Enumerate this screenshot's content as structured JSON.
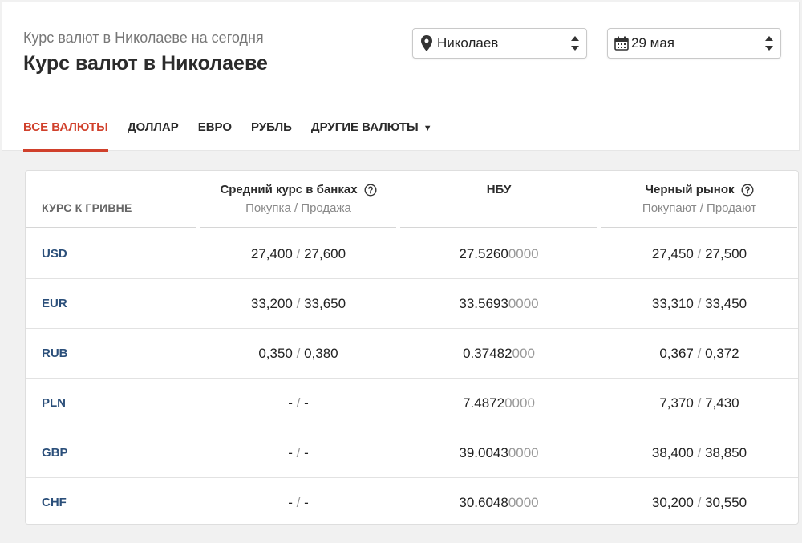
{
  "header": {
    "subtitle": "Курс валют в Николаеве на сегодня",
    "title": "Курс валют в Николаеве",
    "city_select": {
      "value": "Николаев",
      "icon": "map-pin-icon"
    },
    "date_select": {
      "value": "29 мая",
      "icon": "calendar-icon"
    }
  },
  "tabs": [
    {
      "label": "ВСЕ ВАЛЮТЫ",
      "active": true
    },
    {
      "label": "ДОЛЛАР"
    },
    {
      "label": "ЕВРО"
    },
    {
      "label": "РУБЛЬ"
    },
    {
      "label": "ДРУГИЕ ВАЛЮТЫ",
      "caret": "▼"
    }
  ],
  "table": {
    "first_header": "КУРС К ГРИВНЕ",
    "columns": [
      {
        "title": "Средний курс в банках",
        "subtitle": "Покупка / Продажа",
        "help": true
      },
      {
        "title": "НБУ",
        "subtitle": "",
        "help": false
      },
      {
        "title": "Черный рынок",
        "subtitle": "Покупают / Продают",
        "help": true
      }
    ],
    "rows": [
      {
        "code": "USD",
        "bank_buy": "27,400",
        "bank_sell": "27,600",
        "nbu_main": "27.5260",
        "nbu_tail": "0000",
        "black_buy": "27,450",
        "black_sell": "27,500"
      },
      {
        "code": "EUR",
        "bank_buy": "33,200",
        "bank_sell": "33,650",
        "nbu_main": "33.5693",
        "nbu_tail": "0000",
        "black_buy": "33,310",
        "black_sell": "33,450"
      },
      {
        "code": "RUB",
        "bank_buy": "0,350",
        "bank_sell": "0,380",
        "nbu_main": "0.37482",
        "nbu_tail": "000",
        "black_buy": "0,367",
        "black_sell": "0,372"
      },
      {
        "code": "PLN",
        "bank_buy": "-",
        "bank_sell": "-",
        "nbu_main": "7.4872",
        "nbu_tail": "0000",
        "black_buy": "7,370",
        "black_sell": "7,430"
      },
      {
        "code": "GBP",
        "bank_buy": "-",
        "bank_sell": "-",
        "nbu_main": "39.0043",
        "nbu_tail": "0000",
        "black_buy": "38,400",
        "black_sell": "38,850"
      },
      {
        "code": "CHF",
        "bank_buy": "-",
        "bank_sell": "-",
        "nbu_main": "30.6048",
        "nbu_tail": "0000",
        "black_buy": "30,200",
        "black_sell": "30,550"
      }
    ],
    "separator": "/"
  },
  "colors": {
    "accent": "#d0402b",
    "code_link": "#2b4f7a"
  }
}
